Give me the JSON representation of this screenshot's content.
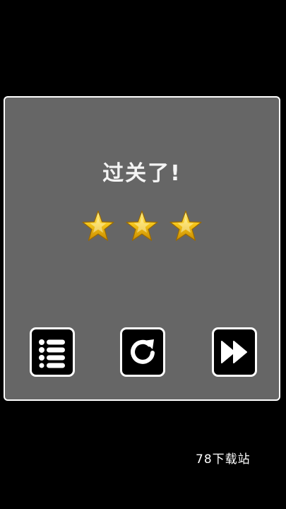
{
  "dialog": {
    "title": "过关了!",
    "stars_earned": 3,
    "stars_total": 3,
    "star_color": "#f5c518"
  },
  "buttons": {
    "menu_icon": "list-menu-icon",
    "retry_icon": "restart-arrow-icon",
    "next_icon": "fast-forward-icon"
  },
  "watermark": "78下载站",
  "colors": {
    "background": "#000000",
    "dialog_bg": "#666666",
    "dialog_border": "#ffffff",
    "button_bg": "#000000",
    "button_border": "#ffffff"
  }
}
